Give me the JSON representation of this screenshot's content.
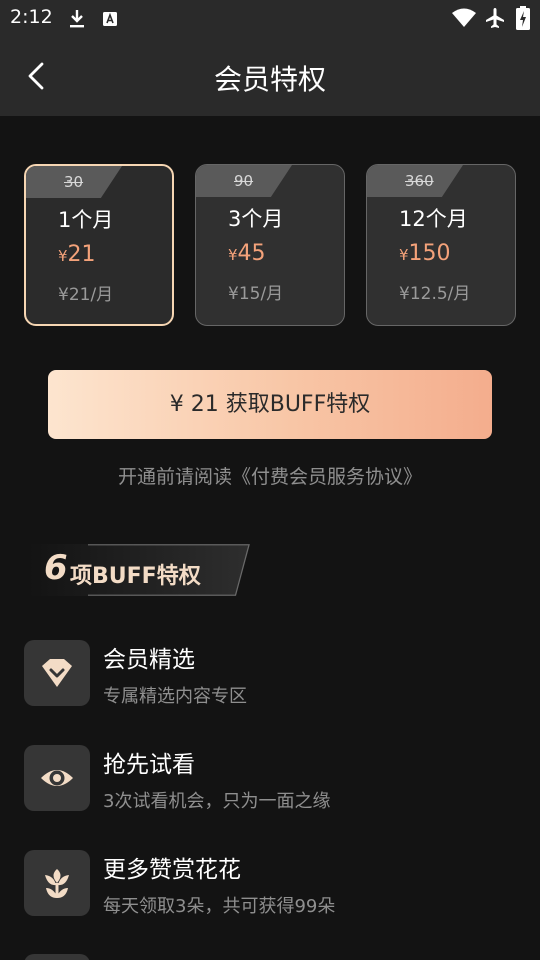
{
  "status_bar": {
    "time": "2:12"
  },
  "app_bar": {
    "title": "会员特权"
  },
  "plans": [
    {
      "original_price": "30",
      "name": "1个月",
      "price_symbol": "¥",
      "price": "21",
      "monthly": "¥21/月",
      "selected": true
    },
    {
      "original_price": "90",
      "name": "3个月",
      "price_symbol": "¥",
      "price": "45",
      "monthly": "¥15/月",
      "selected": false
    },
    {
      "original_price": "360",
      "name": "12个月",
      "price_symbol": "¥",
      "price": "150",
      "monthly": "¥12.5/月",
      "selected": false
    }
  ],
  "buy_button": {
    "label": "¥ 21 获取BUFF特权"
  },
  "agreement": {
    "text": "开通前请阅读《付费会员服务协议》"
  },
  "buff_banner": {
    "count": "6",
    "text": "项BUFF特权"
  },
  "features": [
    {
      "icon": "diamond-icon",
      "title": "会员精选",
      "desc": "专属精选内容专区"
    },
    {
      "icon": "eye-icon",
      "title": "抢先试看",
      "desc": "3次试看机会，只为一面之缘"
    },
    {
      "icon": "flower-icon",
      "title": "更多赞赏花花",
      "desc": "每天领取3朵，共可获得99朵"
    }
  ],
  "colors": {
    "accent": "#f4a27a",
    "selected_border": "#f6d6b3",
    "background": "#131313",
    "bar": "#2a2a2a"
  }
}
